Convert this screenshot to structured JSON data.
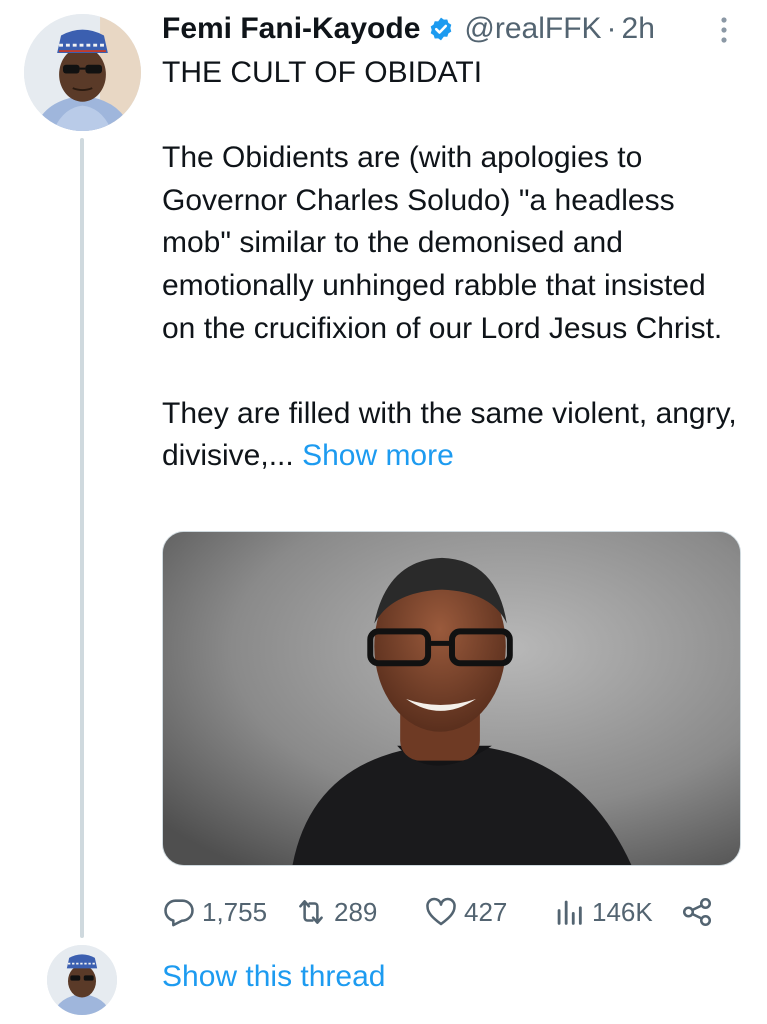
{
  "tweet": {
    "author_name": "Femi Fani-Kayode",
    "handle": "@realFFK",
    "separator": "·",
    "time": "2h",
    "title_line": "THE CULT OF OBIDATI",
    "paragraph_2": "The Obidients are (with apologies to Governor Charles Soludo) \"a headless mob\" similar to the demonised and emotionally unhinged rabble that insisted on the crucifixion of our Lord Jesus Christ.",
    "paragraph_3": "They are filled with the same violent, angry, divisive,...",
    "show_more": "Show more"
  },
  "actions": {
    "replies": "1,755",
    "retweets": "289",
    "likes": "427",
    "views": "146K"
  },
  "thread": {
    "show_thread": "Show this thread"
  },
  "colors": {
    "accent": "#1d9bf0",
    "secondary_text": "#536471",
    "thread_line": "#cfd9de"
  },
  "icons": {
    "verified": "verified-badge-icon",
    "more": "more-vertical-icon",
    "reply": "reply-icon",
    "retweet": "retweet-icon",
    "like": "heart-icon",
    "views": "views-chart-icon",
    "share": "share-icon"
  }
}
